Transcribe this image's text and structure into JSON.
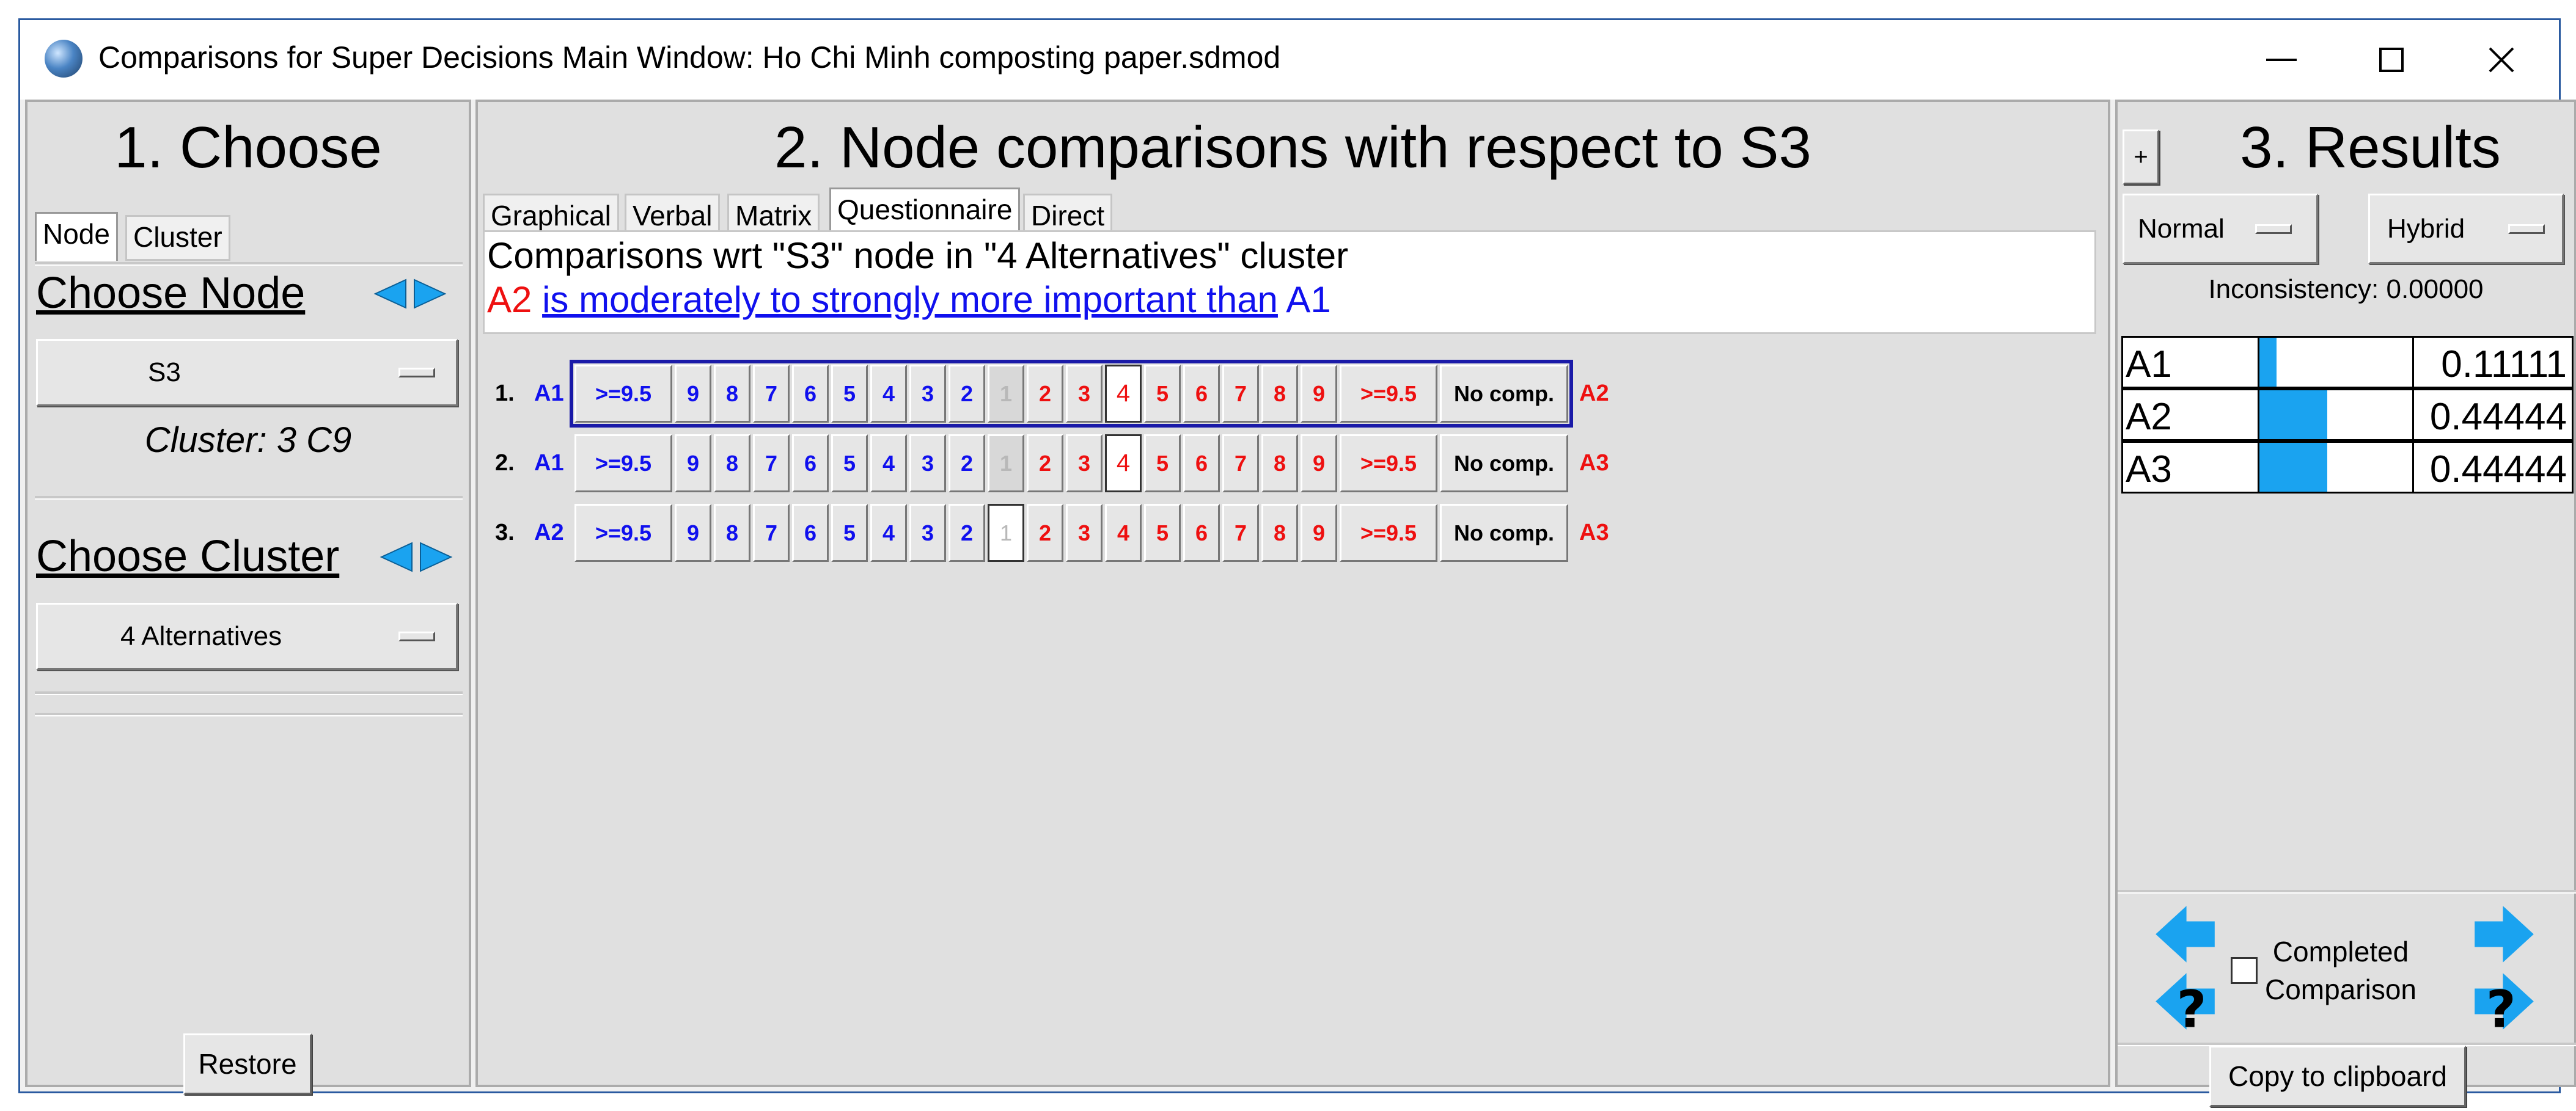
{
  "window": {
    "title": "Comparisons for Super Decisions Main Window: Ho Chi Minh  composting paper.sdmod"
  },
  "colors": {
    "blue_text": "#1010ee",
    "red_text": "#ee1010",
    "bar_fill": "#1aa3f0",
    "selection_frame": "#1a1aa8"
  },
  "choose": {
    "title": "1. Choose",
    "tabs": [
      "Node",
      "Cluster"
    ],
    "choose_node_label": "Choose Node",
    "node_value": "S3",
    "cluster_text": "Cluster: 3 C9",
    "choose_cluster_label": "Choose Cluster",
    "cluster_value": "4 Alternatives",
    "restore_label": "Restore"
  },
  "comparisons": {
    "title": "2. Node comparisons with respect to S3",
    "tabs": [
      "Graphical",
      "Verbal",
      "Matrix",
      "Questionnaire",
      "Direct"
    ],
    "active_tab": "Questionnaire",
    "header_line": "Comparisons wrt \"S3\" node in \"4 Alternatives\" cluster",
    "verbal_left": "A2",
    "verbal_middle": "is moderately to strongly more important than",
    "verbal_right": "A1",
    "scale": [
      ">=9.5",
      "9",
      "8",
      "7",
      "6",
      "5",
      "4",
      "3",
      "2",
      "1",
      "2",
      "3",
      "4",
      "5",
      "6",
      "7",
      "8",
      "9",
      ">=9.5",
      "No comp."
    ],
    "rows": [
      {
        "num": "1.",
        "left": "A1",
        "right": "A2",
        "selected": "4"
      },
      {
        "num": "2.",
        "left": "A1",
        "right": "A3",
        "selected": "4"
      },
      {
        "num": "3.",
        "left": "A2",
        "right": "A3",
        "selected": "1"
      }
    ]
  },
  "results": {
    "title": "3. Results",
    "plus_label": "+",
    "normal_label": "Normal",
    "hybrid_label": "Hybrid",
    "inconsistency": "Inconsistency: 0.00000",
    "items": [
      {
        "name": "A1",
        "value": "0.11111",
        "fraction": 0.11111
      },
      {
        "name": "A2",
        "value": "0.44444",
        "fraction": 0.44444
      },
      {
        "name": "A3",
        "value": "0.44444",
        "fraction": 0.44444
      }
    ],
    "completed_label_1": "Completed",
    "completed_label_2": "Comparison",
    "question_mark": "?",
    "copy_label": "Copy to clipboard"
  }
}
